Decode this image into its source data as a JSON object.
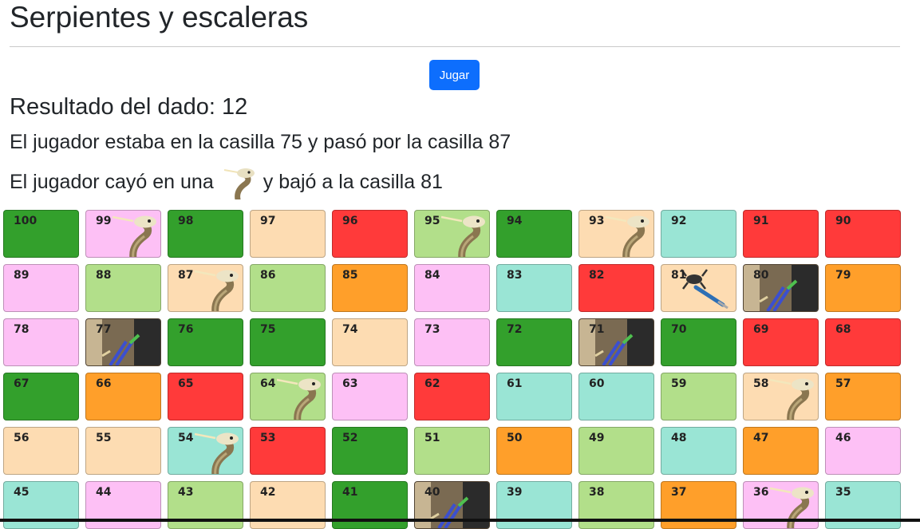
{
  "title": "Serpientes y escaleras",
  "play_button": "Jugar",
  "dice_result": "Resultado del dado: 12",
  "message_passed": "El jugador estaba en la casilla 75 y pasó por la casilla 87",
  "message_landed_prefix": "El jugador cayó en una",
  "message_landed_suffix": "y bajó a la casilla 81",
  "colors": {
    "green": "#33a02c",
    "light-green": "#b2df8a",
    "peach": "#fddcb2",
    "red": "#ff3a3a",
    "pink": "#fdc0f5",
    "teal": "#9ae5d5",
    "orange": "#ff9f2a",
    "button": "#0d6efd"
  },
  "board": [
    [
      {
        "n": "100",
        "c": "green"
      },
      {
        "n": "99",
        "c": "pink",
        "icon": "snake"
      },
      {
        "n": "98",
        "c": "green"
      },
      {
        "n": "97",
        "c": "peach"
      },
      {
        "n": "96",
        "c": "red"
      },
      {
        "n": "95",
        "c": "light",
        "icon": "snake"
      },
      {
        "n": "94",
        "c": "green"
      },
      {
        "n": "93",
        "c": "peach",
        "icon": "snake"
      },
      {
        "n": "92",
        "c": "teal"
      },
      {
        "n": "91",
        "c": "red"
      },
      {
        "n": "90",
        "c": "red"
      }
    ],
    [
      {
        "n": "89",
        "c": "pink"
      },
      {
        "n": "88",
        "c": "light"
      },
      {
        "n": "87",
        "c": "peach",
        "icon": "snake"
      },
      {
        "n": "86",
        "c": "light"
      },
      {
        "n": "85",
        "c": "orange"
      },
      {
        "n": "84",
        "c": "pink"
      },
      {
        "n": "83",
        "c": "teal"
      },
      {
        "n": "82",
        "c": "red"
      },
      {
        "n": "81",
        "c": "peach",
        "icon": "crab"
      },
      {
        "n": "80",
        "c": "photo",
        "icon": "ladder"
      },
      {
        "n": "79",
        "c": "orange"
      }
    ],
    [
      {
        "n": "78",
        "c": "pink"
      },
      {
        "n": "77",
        "c": "photo",
        "icon": "ladder"
      },
      {
        "n": "76",
        "c": "green"
      },
      {
        "n": "75",
        "c": "green"
      },
      {
        "n": "74",
        "c": "peach"
      },
      {
        "n": "73",
        "c": "pink"
      },
      {
        "n": "72",
        "c": "green"
      },
      {
        "n": "71",
        "c": "photo",
        "icon": "ladder"
      },
      {
        "n": "70",
        "c": "green"
      },
      {
        "n": "69",
        "c": "red"
      },
      {
        "n": "68",
        "c": "red"
      }
    ],
    [
      {
        "n": "67",
        "c": "green"
      },
      {
        "n": "66",
        "c": "orange"
      },
      {
        "n": "65",
        "c": "red"
      },
      {
        "n": "64",
        "c": "light",
        "icon": "snake"
      },
      {
        "n": "63",
        "c": "pink"
      },
      {
        "n": "62",
        "c": "red"
      },
      {
        "n": "61",
        "c": "teal"
      },
      {
        "n": "60",
        "c": "teal"
      },
      {
        "n": "59",
        "c": "light"
      },
      {
        "n": "58",
        "c": "peach",
        "icon": "snake"
      },
      {
        "n": "57",
        "c": "orange"
      }
    ],
    [
      {
        "n": "56",
        "c": "peach"
      },
      {
        "n": "55",
        "c": "peach"
      },
      {
        "n": "54",
        "c": "teal",
        "icon": "snake"
      },
      {
        "n": "53",
        "c": "red"
      },
      {
        "n": "52",
        "c": "green"
      },
      {
        "n": "51",
        "c": "light"
      },
      {
        "n": "50",
        "c": "orange"
      },
      {
        "n": "49",
        "c": "light"
      },
      {
        "n": "48",
        "c": "teal"
      },
      {
        "n": "47",
        "c": "orange"
      },
      {
        "n": "46",
        "c": "pink"
      }
    ],
    [
      {
        "n": "45",
        "c": "teal"
      },
      {
        "n": "44",
        "c": "pink"
      },
      {
        "n": "43",
        "c": "light"
      },
      {
        "n": "42",
        "c": "peach"
      },
      {
        "n": "41",
        "c": "green"
      },
      {
        "n": "40",
        "c": "photo",
        "icon": "ladder"
      },
      {
        "n": "39",
        "c": "teal"
      },
      {
        "n": "38",
        "c": "light"
      },
      {
        "n": "37",
        "c": "orange"
      },
      {
        "n": "36",
        "c": "pink",
        "icon": "snake"
      },
      {
        "n": "35",
        "c": "teal"
      }
    ]
  ]
}
